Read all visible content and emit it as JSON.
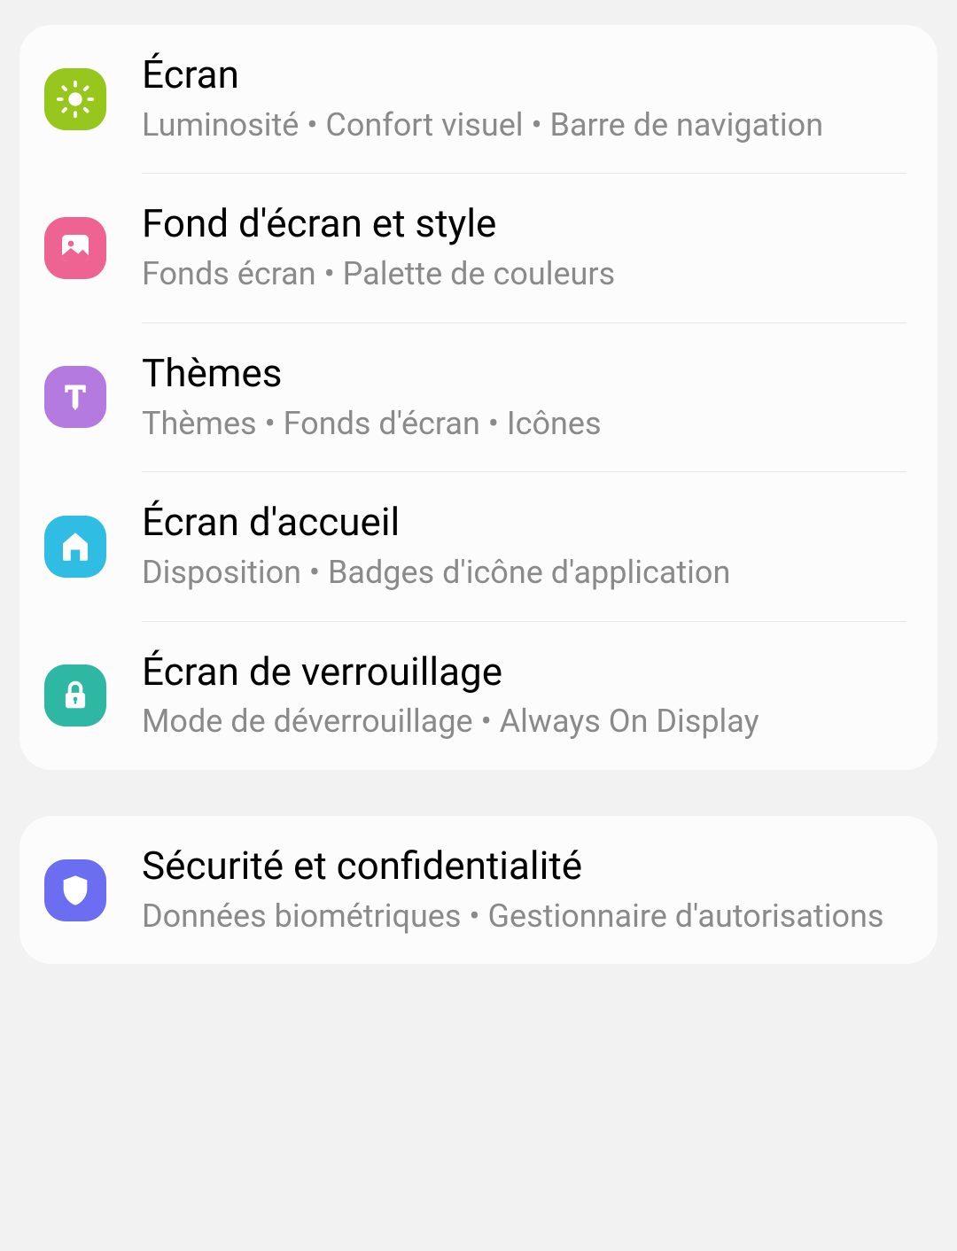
{
  "settings": {
    "group1": [
      {
        "title": "Écran",
        "subtitle": "Luminosité  •  Confort visuel  •  Barre de navigation"
      },
      {
        "title": "Fond d'écran et style",
        "subtitle": "Fonds écran  •  Palette de couleurs"
      },
      {
        "title": "Thèmes",
        "subtitle": "Thèmes  •  Fonds d'écran  •  Icônes"
      },
      {
        "title": "Écran d'accueil",
        "subtitle": "Disposition  •  Badges d'icône d'application"
      },
      {
        "title": "Écran de verrouillage",
        "subtitle": "Mode de déverrouillage  •  Always On Display"
      }
    ],
    "group2": [
      {
        "title": "Sécurité et confidentialité",
        "subtitle": "Données biométriques  •  Gestionnaire d'autorisations"
      }
    ]
  }
}
